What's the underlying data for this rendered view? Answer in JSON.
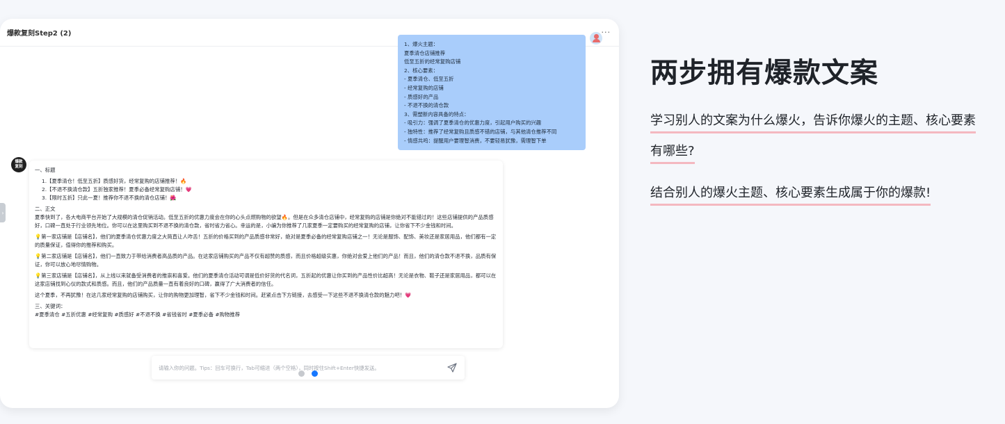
{
  "window": {
    "title": "爆款复刻Step2 (2)",
    "more_label": "···"
  },
  "user_message": {
    "lines": [
      "1、爆火主题：",
      "夏季清仓店铺推荐",
      "低至五折的经常复购店铺",
      "2、核心要素：",
      "- 夏季清仓、低至五折",
      "- 经常复购的店铺",
      "- 质感好的产品",
      "- 不退不换的清仓款",
      "3、需塑新内容具备的特点：",
      "- 吸引力：强调了夏季清仓的优惠力度，引起用户购买的兴趣",
      "- 独特性：推荐了经常复购且质感不错的店铺，与其他清仓推荐不同",
      "- 情感共鸣：提醒用户要理智消费，不要轻易犹豫，需理智下单"
    ]
  },
  "bot": {
    "avatar_text": "爆款\n复刻",
    "section1_title": "一、标题",
    "titles": [
      "1.【夏季清仓！低至五折】质感好货，经常复购的店铺推荐！🔥",
      "2.【不退不换清仓款】五折独家推荐！夏季必备经常复购店铺！💗",
      "3.【限时五折】只此一夏！推荐你不退不换的清仓店铺！🌺"
    ],
    "section2_title": "二、正文",
    "intro": "夏季快到了，各大电商平台开始了大规模的清仓促销活动。低至五折的优惠力度会在你的心头点燃购物的欲望🔥。但是在众多清仓店铺中，经常复购的店铺是你绝对不能错过的！这些店铺提供的产品质感好，口碑一直处于行业领先地位。你可以在这里购买到不退不换的清仓款，省时省力省心。幸运的是，小编为你推荐了几家夏季一定要购买的经常复购的店铺，让你省下不少金钱和时间。",
    "shops": [
      "💡第一家店铺是【店铺名】，他们的夏季清仓优惠力度之大简直让人咋舌！五折的价格买到的产品质感非常好，绝对是夏季必备的经常复购店铺之一！无论是服饰、配饰、美妆还是家居用品，他们都有一定的质量保证，值得你的推荐和购买。",
      "💡第二家店铺是【店铺名】，他们一直致力于带给消费者高品质的产品。在这家店铺购买的产品不仅有超赞的质感，而且价格超级实惠，你绝对会爱上他们的产品！而且，他们的清仓款不退不换，品质有保证，你可以放心地尽情购物。",
      "💡第三家店铺是【店铺名】，从上线以来就备受消费者的推崇和喜爱。他们的夏季清仓活动可谓是低价好货的代名词，五折起的优惠让你买到的产品性价比超高！无论是衣物、鞋子还是家居用品，都可以在这家店铺找到心仪的款式和质感。而且，他们的产品质量一直有着良好的口碑，赢得了广大消费者的信任。"
    ],
    "outro": "这个夏季，不再犹豫！在这几家经常复购的店铺购买，让你的购物更加理智，省下不少金钱和时间。赶紧点击下方链接，去感受一下这些不退不换清仓款的魅力吧！💗",
    "section3_title": "三、关键词：",
    "keywords": "#夏季清仓 #五折优惠 #经常复购 #质感好 #不退不换 #省钱省时 #夏季必备 #购物推荐"
  },
  "input": {
    "placeholder": "请输入你的问题。Tips：回车可换行，Tab可缩进（两个空格），同时按住Shift+Enter快捷发送。"
  },
  "carousel": {
    "count": 2,
    "active_index": 1
  },
  "promo": {
    "headline": "两步拥有爆款文案",
    "desc1": "学习别人的文案为什么爆火，告诉你爆火的主题、核心要素有哪些?",
    "desc2": "结合别人的爆火主题、核心要素生成属于你的爆款!"
  },
  "colors": {
    "user_bubble": "#a9cdfb",
    "accent": "#1677ff",
    "underline": "#f4b8c0"
  }
}
